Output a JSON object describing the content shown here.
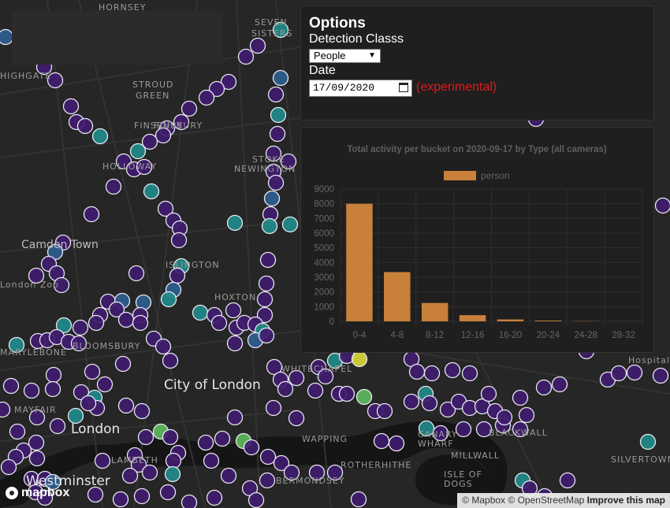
{
  "map": {
    "labels": [
      {
        "text": "HORNSEY",
        "cls": ""
      },
      {
        "text": "SEVEN",
        "cls": ""
      },
      {
        "text": "SISTERS",
        "cls": ""
      },
      {
        "text": "HIGHGATE",
        "cls": ""
      },
      {
        "text": "STROUD",
        "cls": ""
      },
      {
        "text": "GREEN",
        "cls": ""
      },
      {
        "text": "FINSBURY",
        "cls": ""
      },
      {
        "text": "HOLLOWAY",
        "cls": ""
      },
      {
        "text": "STOKE",
        "cls": ""
      },
      {
        "text": "NEWINGTON",
        "cls": ""
      },
      {
        "text": "Camden Town",
        "cls": "mid"
      },
      {
        "text": "ISLINGTON",
        "cls": ""
      },
      {
        "text": "London Zoo",
        "cls": ""
      },
      {
        "text": "HOXTON",
        "cls": ""
      },
      {
        "text": "BLOOMSBURY",
        "cls": ""
      },
      {
        "text": "MARYLEBONE",
        "cls": ""
      },
      {
        "text": "WHITECHAPEL",
        "cls": ""
      },
      {
        "text": "City of London",
        "cls": "big"
      },
      {
        "text": "MAYFAIR",
        "cls": ""
      },
      {
        "text": "London",
        "cls": "big"
      },
      {
        "text": "WAPPING",
        "cls": ""
      },
      {
        "text": "ROTHERHITHE",
        "cls": ""
      },
      {
        "text": "CANARY",
        "cls": ""
      },
      {
        "text": "WHARF",
        "cls": ""
      },
      {
        "text": "MILLWALL",
        "cls": ""
      },
      {
        "text": "ISLE OF",
        "cls": ""
      },
      {
        "text": "DOGS",
        "cls": ""
      },
      {
        "text": "BERMONDSEY",
        "cls": ""
      },
      {
        "text": "Westminster",
        "cls": "big"
      },
      {
        "text": "LAMBETH",
        "cls": ""
      },
      {
        "text": "Hospital",
        "cls": ""
      },
      {
        "text": "SILVERTOWN",
        "cls": ""
      },
      {
        "text": "BLACKWALL",
        "cls": ""
      },
      {
        "text": "FINSBURY",
        "cls": ""
      }
    ],
    "marker_colors": {
      "purple": "#3f1b6e",
      "teal": "#1f8a8a",
      "blue": "#2e5d8f",
      "green": "#5cb85c",
      "yellow": "#d6d63a"
    }
  },
  "options": {
    "title": "Options",
    "class_label": "Detection Classs",
    "class_value": "People",
    "date_label": "Date",
    "date_value": "17/09/2020",
    "experimental": "(experimental)"
  },
  "chart_data": {
    "type": "bar",
    "title": "Total activity per bucket on 2020-09-17 by Type (all cameras)",
    "categories": [
      "0-4",
      "4-8",
      "8-12",
      "12-16",
      "16-20",
      "20-24",
      "24-28",
      "28-32"
    ],
    "series": [
      {
        "name": "person",
        "values": [
          8000,
          3350,
          1250,
          420,
          130,
          50,
          15,
          5
        ]
      }
    ],
    "ylim": [
      0,
      9000
    ],
    "yticks": [
      0,
      1000,
      2000,
      3000,
      4000,
      5000,
      6000,
      7000,
      8000,
      9000
    ],
    "legend": "top",
    "bar_color": "#c8803a"
  },
  "attribution": {
    "mapbox": "© Mapbox",
    "osm": "© OpenStreetMap",
    "improve": "Improve this map",
    "logo": "mapbox"
  }
}
